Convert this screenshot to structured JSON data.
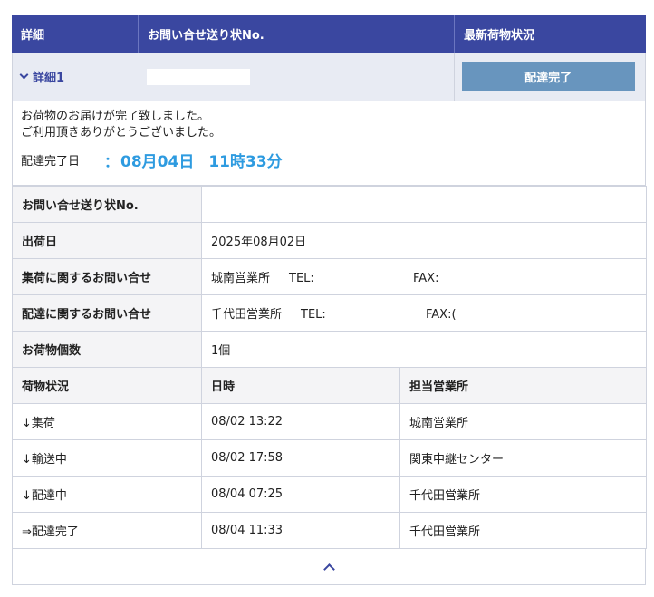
{
  "header": {
    "col_detail": "詳細",
    "col_slip": "お問い合せ送り状No.",
    "col_status": "最新荷物状況"
  },
  "summary": {
    "detail_link": "詳細1",
    "status_button": "配達完了"
  },
  "message": {
    "line1": "お荷物のお届けが完了致しました。",
    "line2": "ご利用頂きありがとうございました。",
    "done_label": "配達完了日",
    "done_colon": "：",
    "done_date": "08月04日",
    "done_time": "11時33分"
  },
  "info": {
    "slip_label": "お問い合せ送り状No.",
    "slip_value": "",
    "ship_date_label": "出荷日",
    "ship_date_value": "2025年08月02日",
    "pickup_label": "集荷に関するお問い合せ",
    "pickup_office": "城南営業所",
    "pickup_tel": "TEL:",
    "pickup_fax": "FAX:",
    "delivery_label": "配達に関するお問い合せ",
    "delivery_office": "千代田営業所",
    "delivery_tel": "TEL:",
    "delivery_fax": "FAX:(",
    "count_label": "お荷物個数",
    "count_value": "1個"
  },
  "history": {
    "headers": [
      "荷物状況",
      "日時",
      "担当営業所"
    ],
    "rows": [
      {
        "status": "↓集荷",
        "datetime": "08/02 13:22",
        "office": "城南営業所"
      },
      {
        "status": "↓輸送中",
        "datetime": "08/02 17:58",
        "office": "関東中継センター"
      },
      {
        "status": "↓配達中",
        "datetime": "08/04 07:25",
        "office": "千代田営業所"
      },
      {
        "status": "⇒配達完了",
        "datetime": "08/04 11:33",
        "office": "千代田営業所"
      }
    ]
  },
  "colors": {
    "header_bg": "#3a47a0",
    "summary_bg": "#e8ebf3",
    "status_button_bg": "#6895be",
    "accent": "#2e9be0"
  },
  "icons": {
    "detail_toggle": "chevron-down-icon",
    "collapse": "chevron-up-icon"
  }
}
